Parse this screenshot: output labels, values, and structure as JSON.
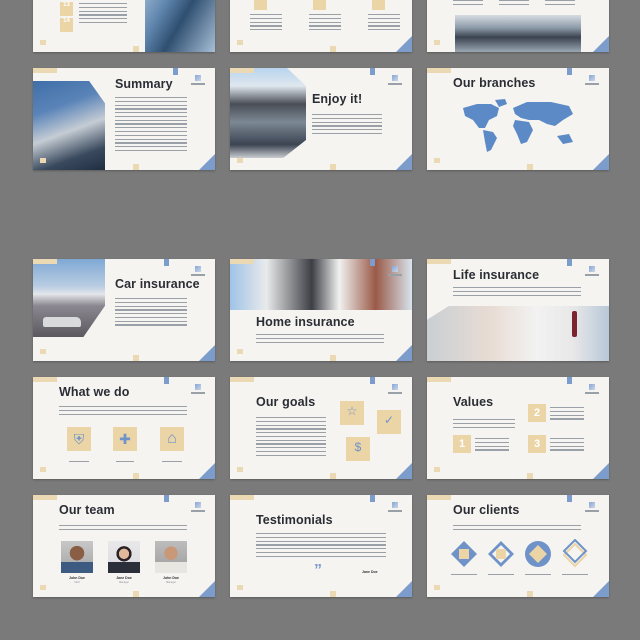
{
  "page": {
    "background": "#7a7a7a"
  },
  "colors": {
    "accent_blue": "#7c9ccc",
    "accent_tan": "#ebd4a6",
    "title": "#2a2d34",
    "slide_bg": "#f6f4f1"
  },
  "brand": {
    "logo_icon": "building-logo-icon"
  },
  "slides": [
    {
      "id": "timeline",
      "title": ""
    },
    {
      "id": "three-steps",
      "title": ""
    },
    {
      "id": "three-columns-photo",
      "title": ""
    },
    {
      "id": "summary",
      "title": "Summary"
    },
    {
      "id": "enjoy",
      "title": "Enjoy it!"
    },
    {
      "id": "branches",
      "title": "Our branches"
    },
    {
      "id": "car",
      "title": "Car insurance"
    },
    {
      "id": "home",
      "title": "Home insurance"
    },
    {
      "id": "life",
      "title": "Life insurance"
    },
    {
      "id": "whatwedo",
      "title": "What we do"
    },
    {
      "id": "goals",
      "title": "Our goals"
    },
    {
      "id": "values",
      "title": "Values",
      "numbers": [
        "1",
        "2",
        "3"
      ]
    },
    {
      "id": "team",
      "title": "Our team",
      "members": [
        {
          "name": "John Doe",
          "role": "CEO"
        },
        {
          "name": "Jane Doe",
          "role": "Manager"
        },
        {
          "name": "John Doe",
          "role": "Manager"
        }
      ]
    },
    {
      "id": "testimonials",
      "title": "Testimonials",
      "author": "Jane Doe",
      "quote_glyph": "”"
    },
    {
      "id": "clients",
      "title": "Our clients"
    }
  ],
  "icons": {
    "whatwedo": [
      "shield-icon",
      "plus-icon",
      "house-icon"
    ],
    "goals": [
      "star-icon",
      "check-icon",
      "dollar-icon"
    ]
  },
  "glyphs": {
    "shield": "⛨",
    "plus": "✚",
    "house": "⌂",
    "star": "☆",
    "check": "✓",
    "dollar": "$"
  },
  "timeline_numbers": [
    "13",
    "14"
  ]
}
